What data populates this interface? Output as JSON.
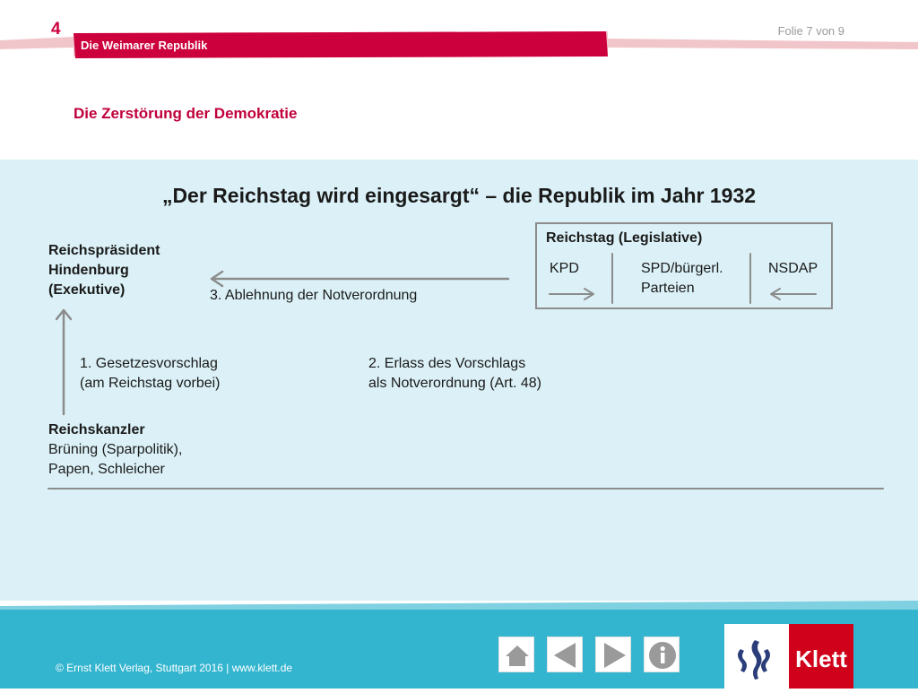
{
  "header": {
    "chapter_number": "4",
    "chapter_label": "Die Weimarer Republik",
    "slide_counter": "Folie 7 von 9",
    "subtitle": "Die Zerstörung der Demokratie"
  },
  "slide": {
    "title": "„Der Reichstag wird eingesargt“ – die Republik im Jahr 1932",
    "president": {
      "line1": "Reichspräsident",
      "line2": "Hindenburg",
      "line3": "(Exekutive)"
    },
    "chancellor": {
      "title": "Reichskanzler",
      "line1": "Brüning (Sparpolitik),",
      "line2": "Papen, Schleicher"
    },
    "reichstag": {
      "title": "Reichstag (Legislative)",
      "party1": "KPD",
      "party2_line1": "SPD/bürgerl.",
      "party2_line2": "Parteien",
      "party3": "NSDAP"
    },
    "step1": {
      "line1": "1. Gesetzesvorschlag",
      "line2": "(am Reichstag vorbei)"
    },
    "step2": {
      "line1": "2. Erlass des Vorschlags",
      "line2": "als Notverordnung (Art. 48)"
    },
    "step3": "3. Ablehnung der Notverordnung"
  },
  "footer": {
    "copyright": "© Ernst Klett Verlag, Stuttgart 2016 | www.klett.de",
    "nav": {
      "home_icon": "home-icon",
      "prev_icon": "triangle-left-icon",
      "next_icon": "triangle-right-icon",
      "info_icon": "info-icon"
    },
    "logo_text": "Klett"
  },
  "colors": {
    "brand_red": "#cc003d",
    "panel_blue": "#dbf1f7",
    "footer_blue": "#33b5cf",
    "arrow_gray": "#8c8c8c"
  }
}
